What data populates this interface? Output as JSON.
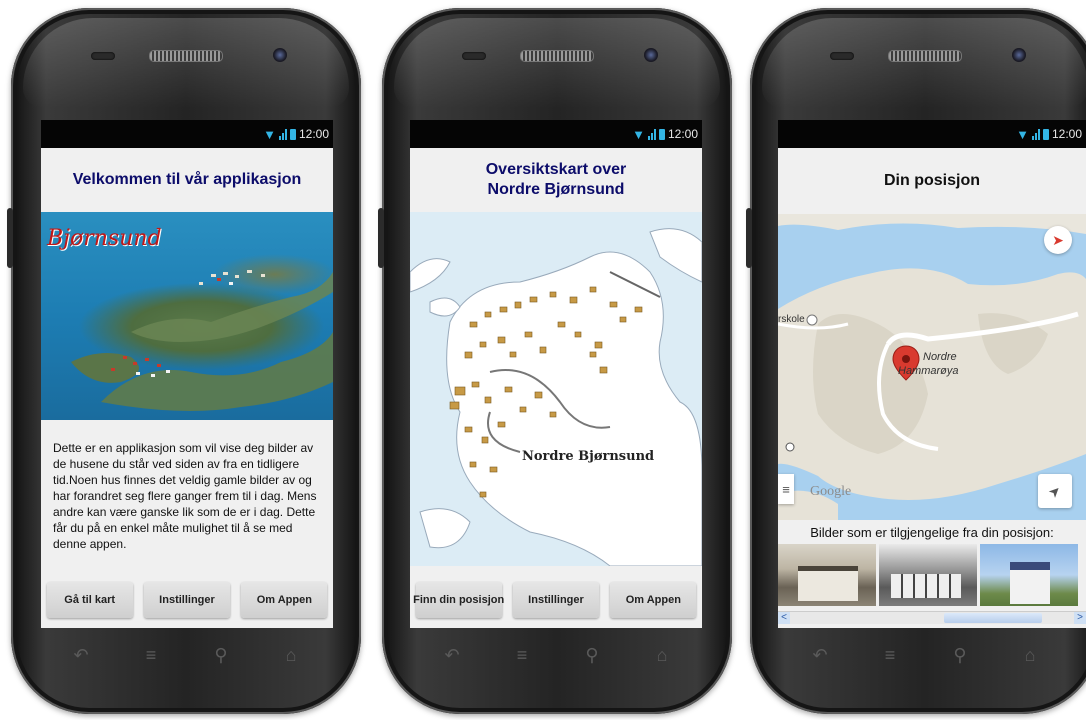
{
  "status_bar": {
    "time": "12:00"
  },
  "screens": [
    {
      "title": "Velkommen til vår applikasjon",
      "logo_text": "Bjørnsund",
      "description": "Dette er en applikasjon som vil vise deg bilder av de husene du står ved siden av fra en tidligere tid.Noen hus finnes det veldig gamle bilder av og har forandret seg flere ganger frem til i dag. Mens andre kan være ganske lik som de er i dag. Dette får du på en enkel måte mulighet til å se med denne appen.",
      "buttons": [
        "Gå til kart",
        "Instillinger",
        "Om Appen"
      ]
    },
    {
      "title_line1": "Oversiktskart over",
      "title_line2": "Nordre Bjørnsund",
      "map_label": "Nordre Bjørnsund",
      "buttons": [
        "Finn din posisjon",
        "Instillinger",
        "Om Appen"
      ]
    },
    {
      "title": "Din posisjon",
      "map_place_line1": "Nordre",
      "map_place_line2": "Hammarøya",
      "map_school_label": "rskole",
      "map_attribution": "Google",
      "photos_caption": "Bilder som er tilgjengelige fra din posisjon:"
    }
  ],
  "colors": {
    "title_blue": "#0c0c6a",
    "status_blue": "#33b5e5",
    "map_pin": "#d93a2f"
  }
}
